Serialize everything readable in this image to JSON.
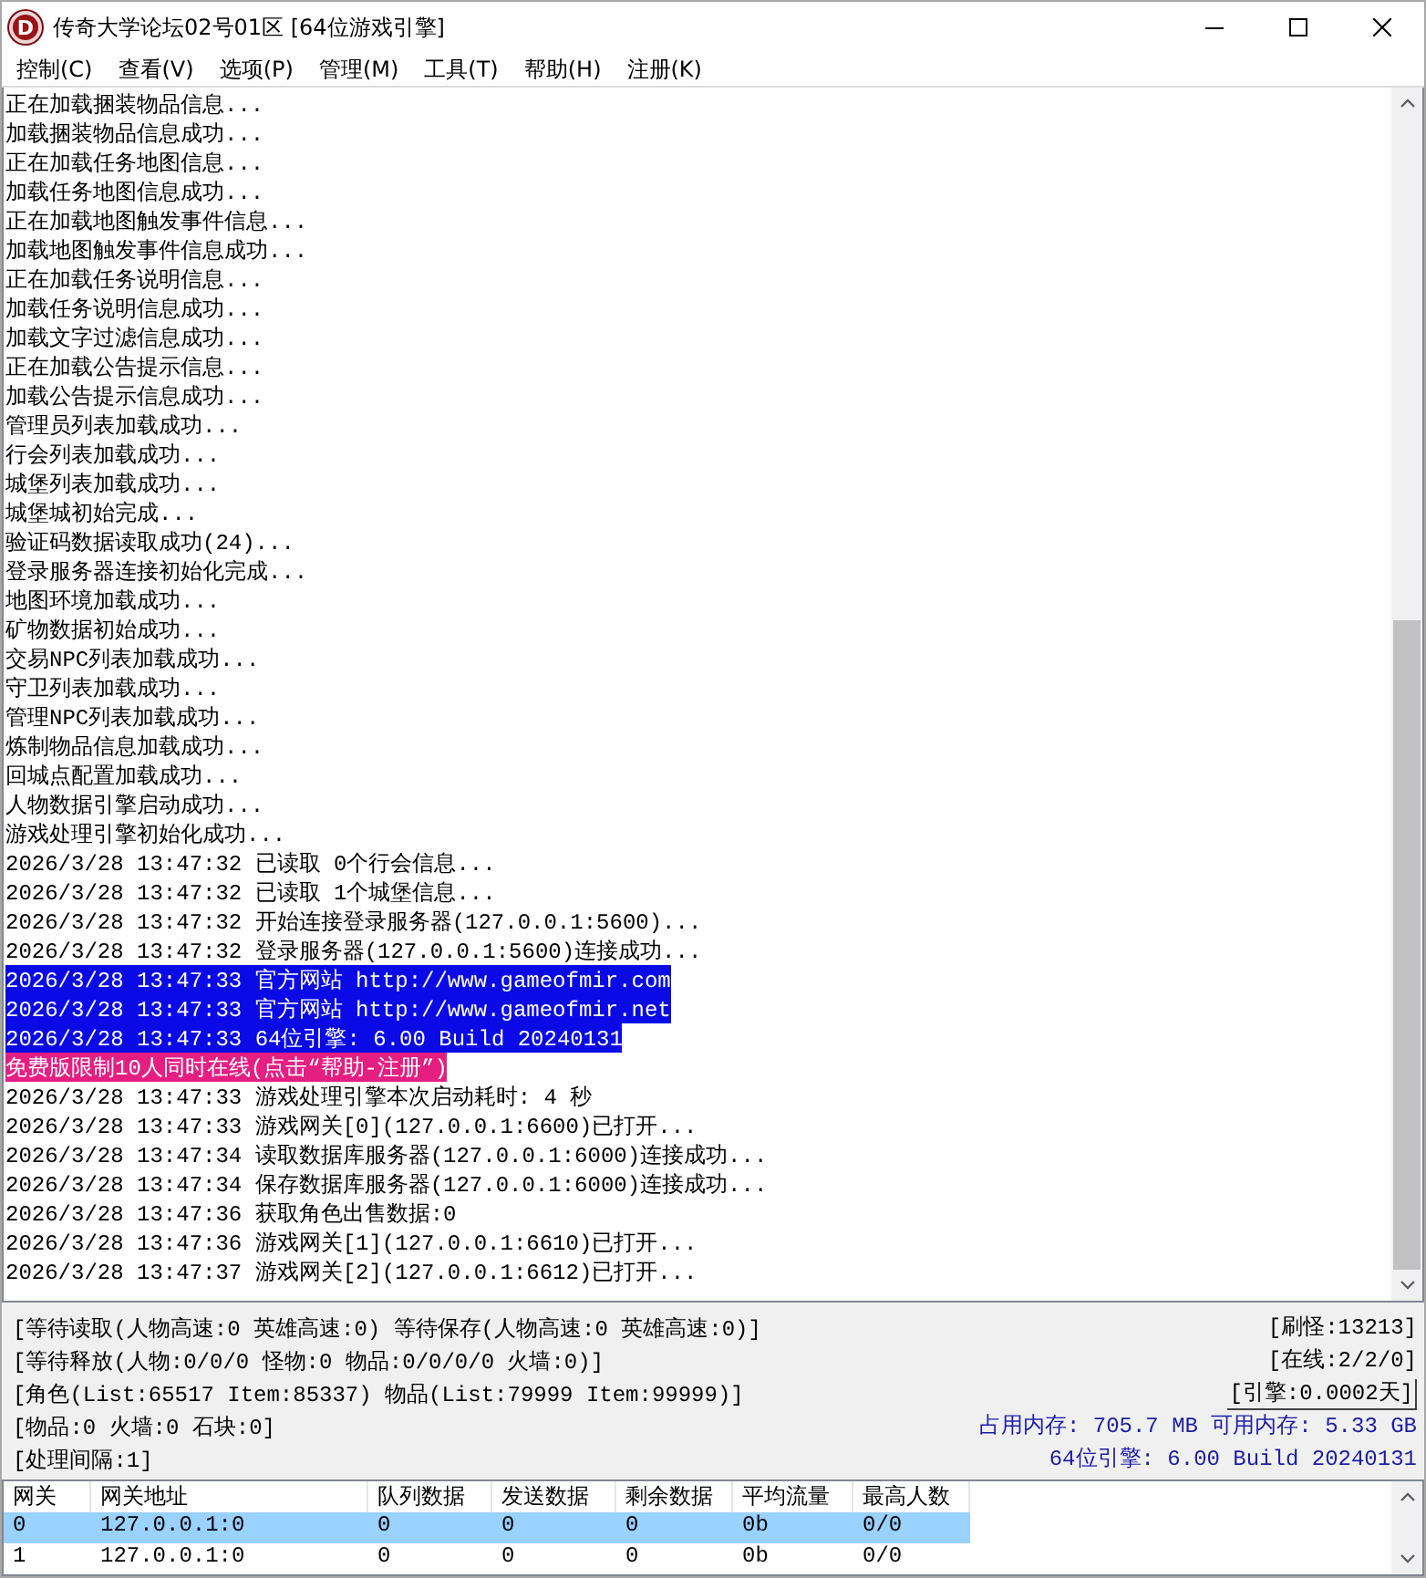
{
  "window": {
    "icon_letter": "D",
    "title": "传奇大学论坛02号01区 [64位游戏引擎]"
  },
  "menu": [
    "控制(C)",
    "查看(V)",
    "选项(P)",
    "管理(M)",
    "工具(T)",
    "帮助(H)",
    "注册(K)"
  ],
  "log": [
    {
      "text": "正在加载捆装物品信息..."
    },
    {
      "text": "加载捆装物品信息成功..."
    },
    {
      "text": "正在加载任务地图信息..."
    },
    {
      "text": "加载任务地图信息成功..."
    },
    {
      "text": "正在加载地图触发事件信息..."
    },
    {
      "text": "加载地图触发事件信息成功..."
    },
    {
      "text": "正在加载任务说明信息..."
    },
    {
      "text": "加载任务说明信息成功..."
    },
    {
      "text": "加载文字过滤信息成功..."
    },
    {
      "text": "正在加载公告提示信息..."
    },
    {
      "text": "加载公告提示信息成功..."
    },
    {
      "text": "管理员列表加载成功..."
    },
    {
      "text": "行会列表加载成功..."
    },
    {
      "text": "城堡列表加载成功..."
    },
    {
      "text": "城堡城初始完成..."
    },
    {
      "text": "验证码数据读取成功(24)..."
    },
    {
      "text": "登录服务器连接初始化完成..."
    },
    {
      "text": "地图环境加载成功..."
    },
    {
      "text": "矿物数据初始成功..."
    },
    {
      "text": "交易NPC列表加载成功..."
    },
    {
      "text": "守卫列表加载成功..."
    },
    {
      "text": "管理NPC列表加载成功..."
    },
    {
      "text": "炼制物品信息加载成功..."
    },
    {
      "text": "回城点配置加载成功..."
    },
    {
      "text": "人物数据引擎启动成功..."
    },
    {
      "text": "游戏处理引擎初始化成功..."
    },
    {
      "text": "2026/3/28 13:47:32 已读取 0个行会信息..."
    },
    {
      "text": "2026/3/28 13:47:32 已读取 1个城堡信息..."
    },
    {
      "text": "2026/3/28 13:47:32 开始连接登录服务器(127.0.0.1:5600)..."
    },
    {
      "text": "2026/3/28 13:47:32 登录服务器(127.0.0.1:5600)连接成功..."
    },
    {
      "text": "2026/3/28 13:47:33 官方网站 http://www.gameofmir.com",
      "color": "#0a0ae6"
    },
    {
      "text": "2026/3/28 13:47:33 官方网站 http://www.gameofmir.net",
      "color": "#0a0ae6"
    },
    {
      "text": "2026/3/28 13:47:33 64位引擎: 6.00 Build 20240131",
      "color": "#0a0ae6"
    },
    {
      "text": "免费版限制10人同时在线(点击“帮助-注册”)",
      "color": "#e61e82"
    },
    {
      "text": "2026/3/28 13:47:33 游戏处理引擎本次启动耗时: 4 秒"
    },
    {
      "text": "2026/3/28 13:47:33 游戏网关[0](127.0.0.1:6600)已打开..."
    },
    {
      "text": "2026/3/28 13:47:34 读取数据库服务器(127.0.0.1:6000)连接成功..."
    },
    {
      "text": "2026/3/28 13:47:34 保存数据库服务器(127.0.0.1:6000)连接成功..."
    },
    {
      "text": "2026/3/28 13:47:36 获取角色出售数据:0"
    },
    {
      "text": "2026/3/28 13:47:36 游戏网关[1](127.0.0.1:6610)已打开..."
    },
    {
      "text": "2026/3/28 13:47:37 游戏网关[2](127.0.0.1:6612)已打开..."
    }
  ],
  "status": {
    "left": [
      "[等待读取(人物高速:0 英雄高速:0) 等待保存(人物高速:0 英雄高速:0)]",
      "[等待释放(人物:0/0/0 怪物:0 物品:0/0/0/0 火墙:0)]",
      "[角色(List:65517 Item:85337) 物品(List:79999 Item:99999)]",
      "[物品:0 火墙:0 石块:0]",
      "[处理间隔:1]"
    ],
    "right": [
      {
        "text": "[刷怪:13213]",
        "kind": "plain"
      },
      {
        "text": "[在线:2/2/0]",
        "kind": "plain"
      },
      {
        "text": "[引擎:0.0002天]",
        "kind": "framed"
      },
      {
        "text": "占用内存: 705.7 MB 可用内存: 5.33 GB",
        "kind": "info"
      },
      {
        "text": "64位引擎: 6.00 Build 20240131",
        "kind": "info"
      }
    ]
  },
  "gateways": {
    "columns": [
      "网关",
      "网关地址",
      "队列数据",
      "发送数据",
      "剩余数据",
      "平均流量",
      "最高人数"
    ],
    "rows": [
      {
        "cells": [
          "0",
          "127.0.0.1:0",
          "0",
          "0",
          "0",
          "0b",
          "0/0"
        ],
        "selected": true
      },
      {
        "cells": [
          "1",
          "127.0.0.1:0",
          "0",
          "0",
          "0",
          "0b",
          "0/0"
        ],
        "selected": false
      }
    ]
  }
}
